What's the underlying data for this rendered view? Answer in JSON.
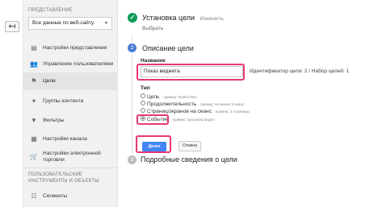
{
  "back_button": {
    "icon": "arrow-left-icon",
    "glyph": "↤"
  },
  "sidebar": {
    "section_view": "ПРЕДСТАВЛЕНИЕ",
    "view_select": {
      "value": "Все данные по веб-сайту",
      "chevron": "▾"
    },
    "items": [
      {
        "label": "Настройки представления",
        "icon": "document-icon",
        "glyph": "▤"
      },
      {
        "label": "Управление пользователями",
        "icon": "users-icon",
        "glyph": "👥"
      },
      {
        "label": "Цели",
        "icon": "flag-icon",
        "glyph": "⚑"
      },
      {
        "label": "Группы контента",
        "icon": "content-groups-icon",
        "glyph": "✦"
      },
      {
        "label": "Фильтры",
        "icon": "filter-icon",
        "glyph": "▼"
      },
      {
        "label": "Настройки канала",
        "icon": "channel-icon",
        "glyph": "▦"
      },
      {
        "label": "Настройки электронной торговли",
        "icon": "cart-icon",
        "glyph": "🛒"
      }
    ],
    "section_tools": "ПОЛЬЗОВАТЕЛЬСКИЕ ИНСТРУМЕНТЫ И ОБЪЕКТЫ",
    "tools_items": [
      {
        "label": "Сегменты",
        "icon": "segments-icon",
        "glyph": "☷"
      }
    ]
  },
  "main": {
    "step1": {
      "check": "✓",
      "title": "Установка цели",
      "edit_link": "Изменить",
      "value": "Выбрать"
    },
    "step2": {
      "number": "2",
      "title": "Описание цели",
      "name_label": "Название",
      "name_value": "Показ виджета",
      "goal_id_text": "Идентификатор цели: 2 / Набор целей: 1",
      "type_label": "Тип",
      "types": [
        {
          "label": "Цель",
          "example": "пример: thanks.html",
          "checked": false
        },
        {
          "label": "Продолжительность",
          "example": "пример: не менее 5 минут",
          "checked": false
        },
        {
          "label": "Страниц/экранов на сеанс",
          "example": "пример: 3 страницы",
          "checked": false
        },
        {
          "label": "Событие",
          "example": "пример: просмотр видео",
          "checked": true
        }
      ],
      "next_button": "Далее",
      "cancel_button": "Отмена"
    },
    "step3": {
      "number": "3",
      "title": "Подробные сведения о цели"
    }
  },
  "colors": {
    "highlight": "#e8376f",
    "primary": "#4285f4",
    "success": "#0f9d58"
  }
}
